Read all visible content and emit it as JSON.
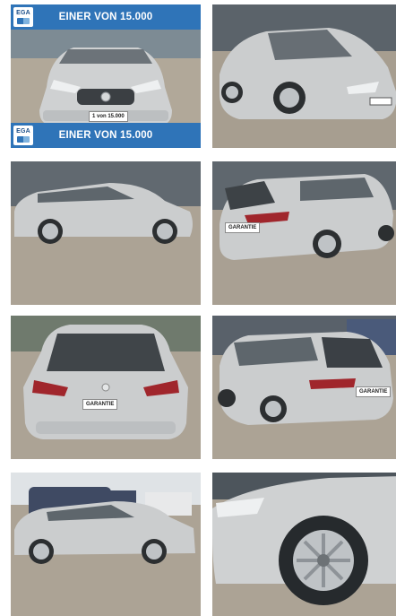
{
  "gallery": {
    "photos": [
      {
        "alt": "front-view",
        "banner_top": "EINER VON 15.000",
        "banner_bottom": "EINER VON 15.000",
        "logo": "EGA",
        "plate": "1 von 15.000"
      },
      {
        "alt": "front-right-three-quarter"
      },
      {
        "alt": "left-side-profile"
      },
      {
        "alt": "rear-left-three-quarter",
        "plate": "GARANTIE"
      },
      {
        "alt": "rear-view",
        "plate": "GARANTIE"
      },
      {
        "alt": "rear-right-three-quarter",
        "plate": "GARANTIE"
      },
      {
        "alt": "left-side-with-van"
      },
      {
        "alt": "front-wheel-detail"
      }
    ]
  },
  "colors": {
    "banner": "#2f74b8",
    "car_body": "#c9cbcc",
    "ground": "#aaa193",
    "building": "#5f666d"
  }
}
